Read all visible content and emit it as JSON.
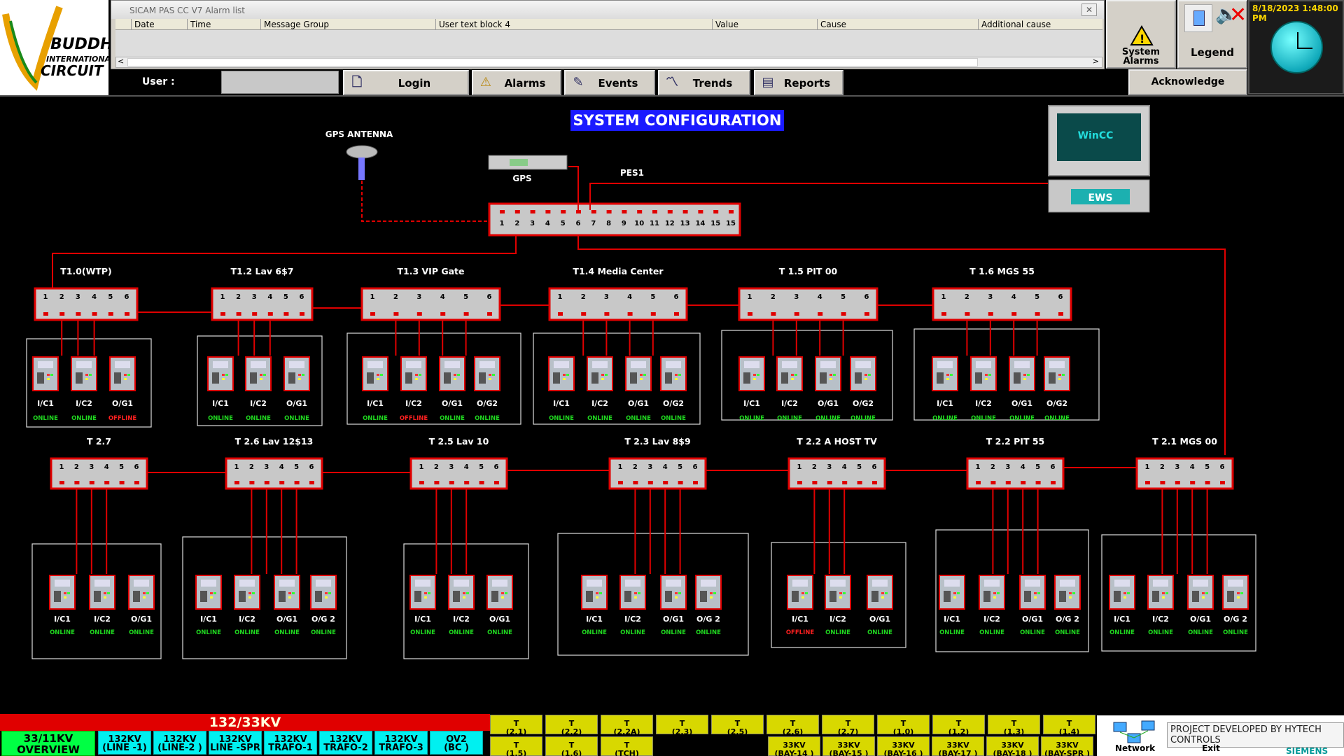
{
  "alarm_window": {
    "title": "SICAM PAS CC V7 Alarm list",
    "columns": [
      "Date",
      "Time",
      "Message Group",
      "User text block 4",
      "Value",
      "Cause",
      "Additional cause"
    ]
  },
  "logo": {
    "line1": "BUDDH",
    "line2": "INTERNATIONAL",
    "line3": "CIRCUIT"
  },
  "userbar": {
    "label": "User :"
  },
  "nav": [
    {
      "label": "Login",
      "icon": "login-icon"
    },
    {
      "label": "Alarms",
      "icon": "warning-icon"
    },
    {
      "label": "Events",
      "icon": "pen-icon"
    },
    {
      "label": "Trends",
      "icon": "trend-icon"
    },
    {
      "label": "Reports",
      "icon": "report-icon"
    }
  ],
  "system_alarms": {
    "label1": "System",
    "label2": "Alarms"
  },
  "legend": {
    "label": "Legend"
  },
  "acknowledge": {
    "label": "Acknowledge"
  },
  "clock": {
    "datetime": "8/18/2023 1:48:00 PM"
  },
  "diagram": {
    "title": "SYSTEM CONFIGURATION",
    "gps_antenna": "GPS ANTENNA",
    "gps": "GPS",
    "pes1": "PES1",
    "ews": "EWS",
    "wincc": "WinCC",
    "pes1_ports": [
      "1",
      "2",
      "3",
      "4",
      "5",
      "6",
      "7",
      "8",
      "9",
      "10",
      "11",
      "12",
      "13",
      "14",
      "15",
      "15"
    ],
    "colors": {
      "online": "#20d820",
      "offline": "#ff2020",
      "link": "#e00000"
    },
    "switches_top": [
      {
        "name": "T1.0(WTP)",
        "ports": [
          "1",
          "2",
          "3",
          "4",
          "5",
          "6"
        ],
        "devices": [
          [
            "I/C1",
            "ONLINE"
          ],
          [
            "I/C2",
            "ONLINE"
          ],
          [
            "O/G1",
            "OFFLINE"
          ]
        ]
      },
      {
        "name": "T1.2 Lav 6$7",
        "ports": [
          "1",
          "2",
          "3",
          "4",
          "5",
          "6"
        ],
        "devices": [
          [
            "I/C1",
            "ONLINE"
          ],
          [
            "I/C2",
            "ONLINE"
          ],
          [
            "O/G1",
            "ONLINE"
          ]
        ]
      },
      {
        "name": "T1.3 VIP Gate",
        "ports": [
          "1",
          "2",
          "3",
          "4",
          "5",
          "6"
        ],
        "devices": [
          [
            "I/C1",
            "ONLINE"
          ],
          [
            "I/C2",
            "OFFLINE"
          ],
          [
            "O/G1",
            "ONLINE"
          ],
          [
            "O/G2",
            "ONLINE"
          ]
        ]
      },
      {
        "name": "T1.4 Media Center",
        "ports": [
          "1",
          "2",
          "3",
          "4",
          "5",
          "6"
        ],
        "devices": [
          [
            "I/C1",
            "ONLINE"
          ],
          [
            "I/C2",
            "ONLINE"
          ],
          [
            "O/G1",
            "ONLINE"
          ],
          [
            "O/G2",
            "ONLINE"
          ]
        ]
      },
      {
        "name": "T 1.5 PIT 00",
        "ports": [
          "1",
          "2",
          "3",
          "4",
          "5",
          "6"
        ],
        "devices": [
          [
            "I/C1",
            "ONLINE"
          ],
          [
            "I/C2",
            "ONLINE"
          ],
          [
            "O/G1",
            "ONLINE"
          ],
          [
            "O/G2",
            "ONLINE"
          ]
        ]
      },
      {
        "name": "T 1.6 MGS 55",
        "ports": [
          "1",
          "2",
          "3",
          "4",
          "5",
          "6"
        ],
        "devices": [
          [
            "I/C1",
            "ONLINE"
          ],
          [
            "I/C2",
            "ONLINE"
          ],
          [
            "O/G1",
            "ONLINE"
          ],
          [
            "O/G2",
            "ONLINE"
          ]
        ]
      }
    ],
    "switches_bottom": [
      {
        "name": "T 2.7",
        "ports": [
          "1",
          "2",
          "3",
          "4",
          "5",
          "6"
        ],
        "devices": [
          [
            "I/C1",
            "ONLINE"
          ],
          [
            "I/C2",
            "ONLINE"
          ],
          [
            "O/G1",
            "ONLINE"
          ]
        ]
      },
      {
        "name": "T 2.6 Lav 12$13",
        "ports": [
          "1",
          "2",
          "3",
          "4",
          "5",
          "6"
        ],
        "devices": [
          [
            "I/C1",
            "ONLINE"
          ],
          [
            "I/C2",
            "ONLINE"
          ],
          [
            "O/G1",
            "ONLINE"
          ],
          [
            "O/G 2",
            "ONLINE"
          ]
        ]
      },
      {
        "name": "T 2.5 Lav 10",
        "ports": [
          "1",
          "2",
          "3",
          "4",
          "5",
          "6"
        ],
        "devices": [
          [
            "I/C1",
            "ONLINE"
          ],
          [
            "I/C2",
            "ONLINE"
          ],
          [
            "O/G1",
            "ONLINE"
          ]
        ]
      },
      {
        "name": "T 2.3 Lav 8$9",
        "ports": [
          "1",
          "2",
          "3",
          "4",
          "5",
          "6"
        ],
        "devices": [
          [
            "I/C1",
            "ONLINE"
          ],
          [
            "I/C2",
            "ONLINE"
          ],
          [
            "O/G1",
            "ONLINE"
          ],
          [
            "O/G 2",
            "ONLINE"
          ]
        ]
      },
      {
        "name": "T 2.2 A HOST TV",
        "ports": [
          "1",
          "2",
          "3",
          "4",
          "5",
          "6"
        ],
        "devices": [
          [
            "I/C1",
            "OFFLINE"
          ],
          [
            "I/C2",
            "ONLINE"
          ],
          [
            "O/G1",
            "ONLINE"
          ]
        ]
      },
      {
        "name": "T 2.2 PIT 55",
        "ports": [
          "1",
          "2",
          "3",
          "4",
          "5",
          "6"
        ],
        "devices": [
          [
            "I/C1",
            "ONLINE"
          ],
          [
            "I/C2",
            "ONLINE"
          ],
          [
            "O/G1",
            "ONLINE"
          ],
          [
            "O/G 2",
            "ONLINE"
          ]
        ]
      },
      {
        "name": "T 2.1 MGS 00",
        "ports": [
          "1",
          "2",
          "3",
          "4",
          "5",
          "6"
        ],
        "devices": [
          [
            "I/C1",
            "ONLINE"
          ],
          [
            "I/C2",
            "ONLINE"
          ],
          [
            "O/G1",
            "ONLINE"
          ],
          [
            "O/G 2",
            "ONLINE"
          ]
        ]
      }
    ]
  },
  "bottom": {
    "voltage_bar": "132/33KV",
    "overview": [
      "33/11KV",
      "OVERVIEW"
    ],
    "cyan": [
      [
        "132KV",
        "(LINE -1)"
      ],
      [
        "132KV",
        "(LINE-2 )"
      ],
      [
        "132KV",
        "LINE -SPR"
      ],
      [
        "132KV",
        "TRAFO-1"
      ],
      [
        "132KV",
        "TRAFO-2"
      ],
      [
        "132KV",
        "TRAFO-3"
      ],
      [
        "OV2",
        "(BC )"
      ]
    ],
    "yellow_top": [
      [
        "T",
        "(2.1)"
      ],
      [
        "T",
        "(2.2)"
      ],
      [
        "T",
        "(2.2A)"
      ],
      [
        "T",
        "(2.3)"
      ],
      [
        "T",
        "(2.5)"
      ],
      [
        "T",
        "(2.6)"
      ],
      [
        "T",
        "(2.7)"
      ],
      [
        "T",
        "(1.0)"
      ],
      [
        "T",
        "(1.2)"
      ],
      [
        "T",
        "(1.3)"
      ],
      [
        "T",
        "(1.4)"
      ]
    ],
    "yellow_bottom": [
      [
        "T",
        "(1.5)"
      ],
      [
        "T",
        "(1.6)"
      ],
      [
        "T",
        "(TCH)"
      ],
      [
        "33KV",
        "(BAY-14 )"
      ],
      [
        "33KV",
        "(BAY-15 )"
      ],
      [
        "33KV",
        "(BAY-16 )"
      ],
      [
        "33KV",
        "(BAY-17 )"
      ],
      [
        "33KV",
        "(BAY-18 )"
      ],
      [
        "33KV",
        "(BAY-SPR )"
      ]
    ],
    "network": "Network",
    "exit": "Exit",
    "credit": "PROJECT DEVELOPED BY HYTECH CONTROLS",
    "brand": "SIEMENS"
  }
}
